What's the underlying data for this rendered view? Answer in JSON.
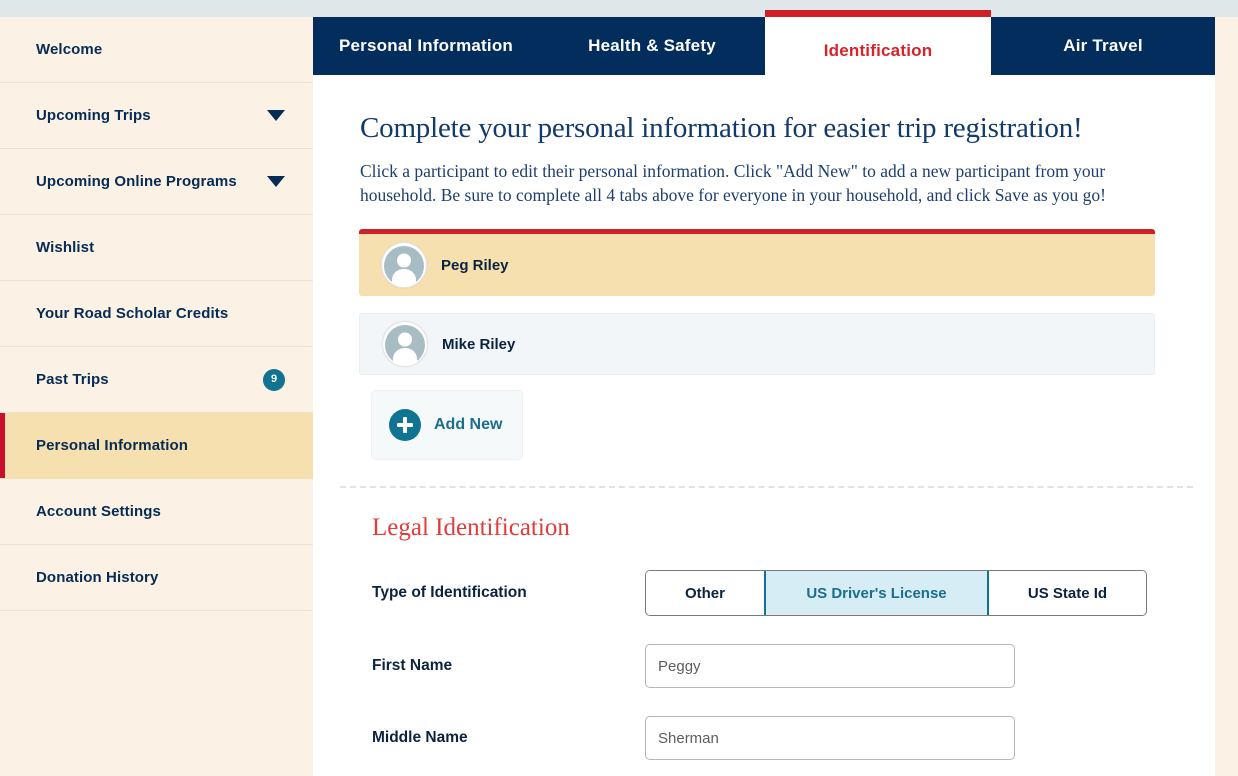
{
  "sidebar": {
    "items": [
      {
        "label": "Welcome",
        "icon": "",
        "badge": "",
        "active": false
      },
      {
        "label": "Upcoming Trips",
        "icon": "chevron-down-icon",
        "badge": "",
        "active": false
      },
      {
        "label": "Upcoming Online Programs",
        "icon": "chevron-down-icon",
        "badge": "",
        "active": false
      },
      {
        "label": "Wishlist",
        "icon": "",
        "badge": "",
        "active": false
      },
      {
        "label": "Your Road Scholar Credits",
        "icon": "",
        "badge": "",
        "active": false
      },
      {
        "label": "Past Trips",
        "icon": "",
        "badge": "9",
        "active": false
      },
      {
        "label": "Personal Information",
        "icon": "",
        "badge": "",
        "active": true
      },
      {
        "label": "Account Settings",
        "icon": "",
        "badge": "",
        "active": false
      },
      {
        "label": "Donation History",
        "icon": "",
        "badge": "",
        "active": false
      }
    ]
  },
  "tabs": [
    {
      "label": "Personal Information",
      "active": false
    },
    {
      "label": "Health & Safety",
      "active": false
    },
    {
      "label": "Identification",
      "active": true
    },
    {
      "label": "Air Travel",
      "active": false
    }
  ],
  "main": {
    "headline": "Complete your personal information for easier trip registration!",
    "subcopy": "Click a participant to edit their personal information. Click \"Add New\" to add a new participant from your household. Be sure to complete all 4 tabs above for everyone in your household, and click Save as you go!",
    "participants": [
      {
        "name": "Peg Riley",
        "selected": true
      },
      {
        "name": "Mike Riley",
        "selected": false
      }
    ],
    "add_new_label": "Add New",
    "section_title": "Legal Identification",
    "fields": {
      "type_of_identification": {
        "label": "Type of Identification",
        "options": [
          "Other",
          "US Driver's License",
          "US State Id"
        ],
        "selected": "US Driver's License"
      },
      "first_name": {
        "label": "First Name",
        "value": "Peggy",
        "placeholder": "First Name"
      },
      "middle_name": {
        "label": "Middle Name",
        "value": "Sherman",
        "placeholder": "Middle Name"
      }
    }
  },
  "colors": {
    "navy": "#032d5c",
    "red": "#d02027",
    "teal": "#0f7391",
    "cream": "#fbf2e5",
    "cream_active": "#f7e0af",
    "section_red": "#e03c3c"
  }
}
